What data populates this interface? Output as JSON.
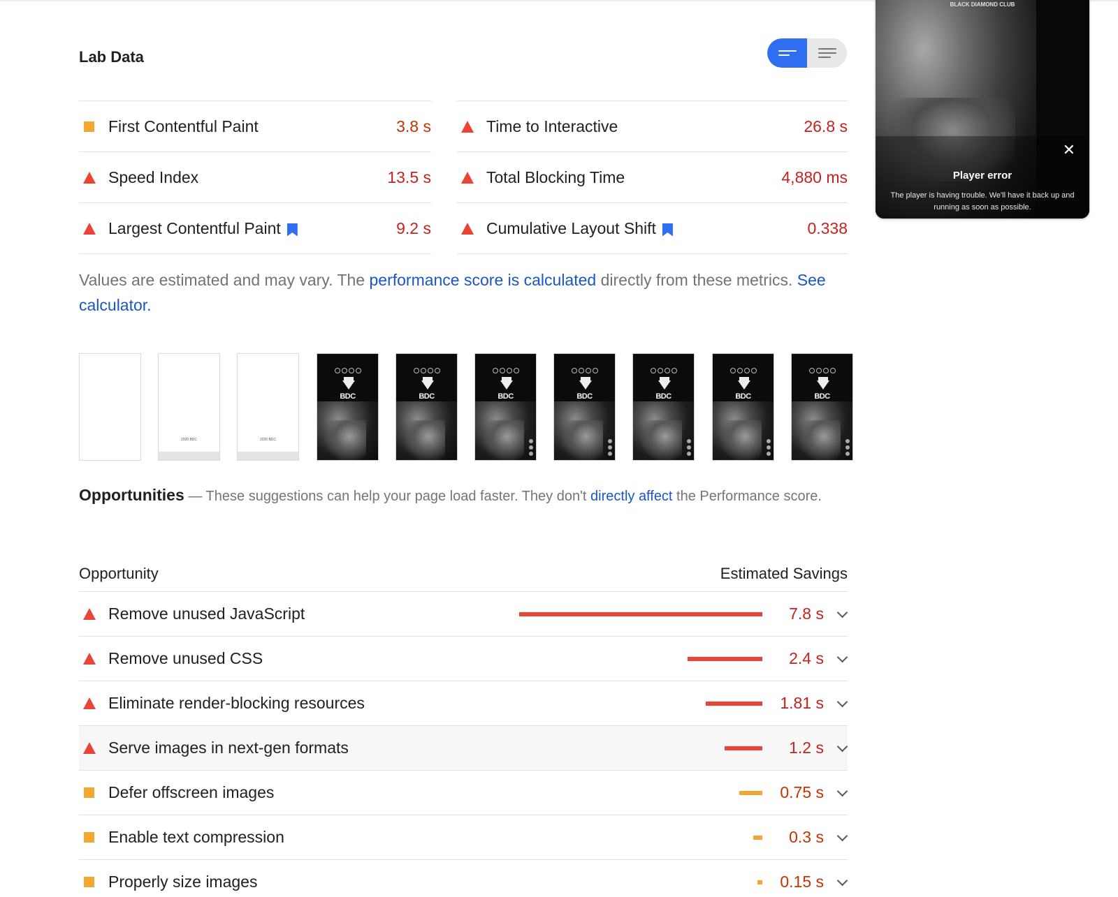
{
  "lab_data": {
    "title": "Lab Data",
    "toggle": {
      "active": "bars-view",
      "inactive": "list-view"
    },
    "metrics_left": [
      {
        "name": "First Contentful Paint",
        "value": "3.8 s",
        "status": "average",
        "flag": false
      },
      {
        "name": "Speed Index",
        "value": "13.5 s",
        "status": "fail",
        "flag": false
      },
      {
        "name": "Largest Contentful Paint",
        "value": "9.2 s",
        "status": "fail",
        "flag": true
      }
    ],
    "metrics_right": [
      {
        "name": "Time to Interactive",
        "value": "26.8 s",
        "status": "fail",
        "flag": false
      },
      {
        "name": "Total Blocking Time",
        "value": "4,880 ms",
        "status": "fail",
        "flag": false
      },
      {
        "name": "Cumulative Layout Shift",
        "value": "0.338",
        "status": "fail",
        "flag": true
      }
    ],
    "note": {
      "part1": "Values are estimated and may vary. The ",
      "link1": "performance score is calculated",
      "part2": " directly from these metrics. ",
      "link2": "See calculator."
    }
  },
  "filmstrip": {
    "frames": [
      {
        "kind": "blank"
      },
      {
        "kind": "loading",
        "caption": "2020 BDC"
      },
      {
        "kind": "loading",
        "caption": "2020 BDC"
      },
      {
        "kind": "dark",
        "logo": "BDC"
      },
      {
        "kind": "dark",
        "logo": "BDC"
      },
      {
        "kind": "dark",
        "logo": "BDC"
      },
      {
        "kind": "dark",
        "logo": "BDC"
      },
      {
        "kind": "dark",
        "logo": "BDC"
      },
      {
        "kind": "dark",
        "logo": "BDC"
      },
      {
        "kind": "dark",
        "logo": "BDC"
      }
    ]
  },
  "preview": {
    "club_name": "BLACK DIAMOND CLUB",
    "close_icon": "close-icon",
    "error_title": "Player error",
    "error_message": "The player is having trouble. We'll have it back up and running as soon as possible."
  },
  "opportunities": {
    "title": "Opportunities",
    "dash": " — ",
    "desc1": "These suggestions can help your page load faster. They don't ",
    "link": "directly affect",
    "desc2": " the Performance score.",
    "col_opportunity": "Opportunity",
    "col_savings": "Estimated Savings",
    "rows": [
      {
        "label": "Remove unused JavaScript",
        "saving": "7.8 s",
        "seconds": 7.8,
        "status": "fail"
      },
      {
        "label": "Remove unused CSS",
        "saving": "2.4 s",
        "seconds": 2.4,
        "status": "fail"
      },
      {
        "label": "Eliminate render-blocking resources",
        "saving": "1.81 s",
        "seconds": 1.81,
        "status": "fail"
      },
      {
        "label": "Serve images in next-gen formats",
        "saving": "1.2 s",
        "seconds": 1.2,
        "status": "fail"
      },
      {
        "label": "Defer offscreen images",
        "saving": "0.75 s",
        "seconds": 0.75,
        "status": "average"
      },
      {
        "label": "Enable text compression",
        "saving": "0.3 s",
        "seconds": 0.3,
        "status": "average"
      },
      {
        "label": "Properly size images",
        "saving": "0.15 s",
        "seconds": 0.15,
        "status": "average"
      }
    ]
  },
  "colors": {
    "fail": "#eb4335",
    "average": "#f4a632",
    "fail_text": "#c5221f",
    "average_text": "#c33300",
    "link": "#1a56c4",
    "accent": "#2f6ef0"
  }
}
